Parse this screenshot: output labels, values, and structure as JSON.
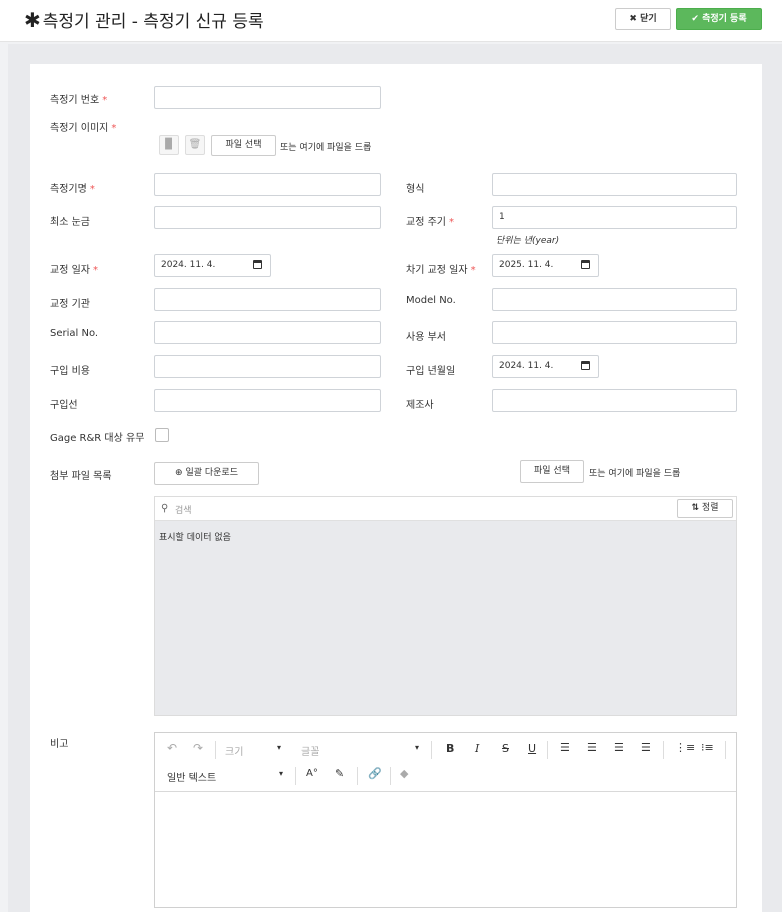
{
  "header": {
    "title": "측정기 관리 - 측정기 신규 등록",
    "close_label": "닫기",
    "register_label": "측정기 등록"
  },
  "form": {
    "instrument_number": {
      "label": "측정기 번호",
      "value": ""
    },
    "instrument_image": {
      "label": "측정기 이미지",
      "file_button": "파일 선택",
      "drop_text": "또는 여기에 파일을 드롭"
    },
    "instrument_name": {
      "label": "측정기명",
      "value": ""
    },
    "model_type": {
      "label": "형식",
      "value": ""
    },
    "min_scale": {
      "label": "최소 눈금",
      "value": ""
    },
    "calibration_cycle": {
      "label": "교정 주기",
      "value": "1",
      "hint": "단위는 년(year)"
    },
    "calibration_date": {
      "label": "교정 일자",
      "value": "2024. 11. 4."
    },
    "next_calibration_date": {
      "label": "차기 교정 일자",
      "value": "2025. 11. 4."
    },
    "calibration_agency": {
      "label": "교정 기관",
      "value": ""
    },
    "model_no": {
      "label": "Model No.",
      "value": ""
    },
    "serial_no": {
      "label": "Serial No.",
      "value": ""
    },
    "department": {
      "label": "사용 부서",
      "value": ""
    },
    "purchase_cost": {
      "label": "구입 비용",
      "value": ""
    },
    "purchase_date": {
      "label": "구입 년월일",
      "value": "2024. 11. 4."
    },
    "supplier": {
      "label": "구입선",
      "value": ""
    },
    "manufacturer": {
      "label": "제조사",
      "value": ""
    },
    "gage_rr": {
      "label": "Gage R&R 대상 유무",
      "checked": false
    },
    "attachments": {
      "label": "첨부 파일 목록",
      "bulk_download": "일괄 다운로드",
      "file_button": "파일 선택",
      "drop_text": "또는 여기에 파일을 드롭",
      "search_placeholder": "검색",
      "sort_label": "정렬",
      "empty_text": "표시할 데이터 없음"
    },
    "remarks": {
      "label": "비고",
      "toolbar": {
        "size": "크기",
        "font": "글꼴",
        "format": "일반 텍스트",
        "bold": "B",
        "italic": "I",
        "strike": "S",
        "underline": "U",
        "font_size_icon": "A°"
      }
    }
  }
}
